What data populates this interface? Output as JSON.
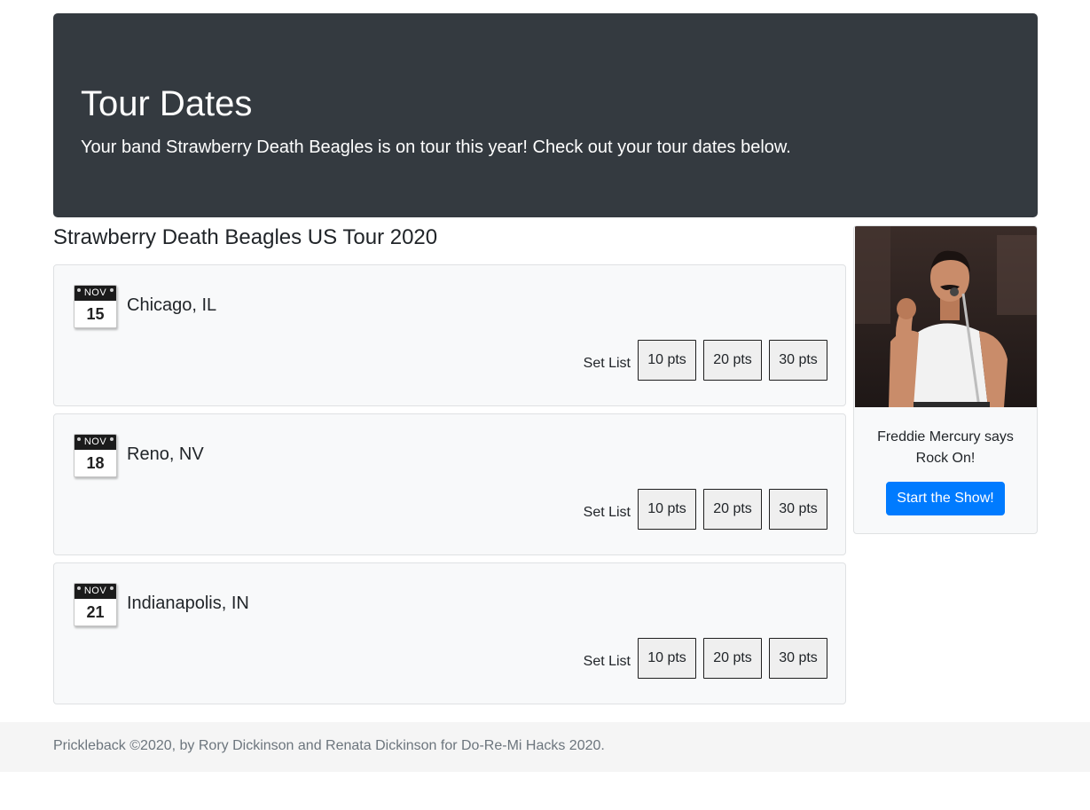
{
  "hero": {
    "title": "Tour Dates",
    "subtitle": "Your band Strawberry Death Beagles is on tour this year! Check out your tour dates below."
  },
  "tour": {
    "heading": "Strawberry Death Beagles US Tour 2020",
    "setlist_label": "Set List",
    "dates": [
      {
        "month": "NOV",
        "day": "15",
        "city": "Chicago, IL",
        "options": [
          "10 pts",
          "20 pts",
          "30 pts"
        ]
      },
      {
        "month": "NOV",
        "day": "18",
        "city": "Reno, NV",
        "options": [
          "10 pts",
          "20 pts",
          "30 pts"
        ]
      },
      {
        "month": "NOV",
        "day": "21",
        "city": "Indianapolis, IN",
        "options": [
          "10 pts",
          "20 pts",
          "30 pts"
        ]
      }
    ]
  },
  "sidebar": {
    "image_icon": "singer-photo",
    "caption": "Freddie Mercury says Rock On!",
    "button_label": "Start the Show!"
  },
  "footer": {
    "text": "Prickleback ©2020, by Rory Dickinson and Renata Dickinson for Do-Re-Mi Hacks 2020."
  },
  "colors": {
    "hero_bg": "#343a40",
    "primary": "#007bff",
    "card_bg": "#f8f9fa",
    "footer_bg": "#f5f5f5"
  }
}
